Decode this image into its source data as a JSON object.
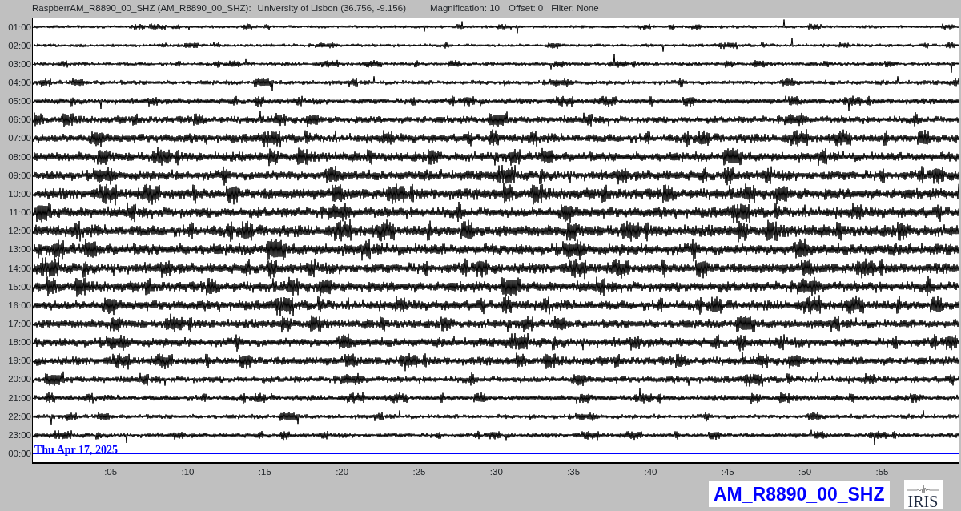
{
  "header": {
    "station": "RaspberrAM_R8890_00_SHZ (AM_R8890_00_SHZ):",
    "location": "University of Lisbon (36.756, -9.156)",
    "magnification": "Magnification: 10",
    "offset": "Offset: 0",
    "filter": "Filter: None"
  },
  "rows": [
    {
      "time": "01:00",
      "kind": "trace"
    },
    {
      "time": "02:00",
      "kind": "trace"
    },
    {
      "time": "03:00",
      "kind": "trace"
    },
    {
      "time": "04:00",
      "kind": "trace"
    },
    {
      "time": "05:00",
      "kind": "trace"
    },
    {
      "time": "06:00",
      "kind": "trace"
    },
    {
      "time": "07:00",
      "kind": "trace"
    },
    {
      "time": "08:00",
      "kind": "trace"
    },
    {
      "time": "09:00",
      "kind": "trace"
    },
    {
      "time": "10:00",
      "kind": "trace"
    },
    {
      "time": "11:00",
      "kind": "trace"
    },
    {
      "time": "12:00",
      "kind": "trace"
    },
    {
      "time": "13:00",
      "kind": "trace"
    },
    {
      "time": "14:00",
      "kind": "trace"
    },
    {
      "time": "15:00",
      "kind": "trace"
    },
    {
      "time": "16:00",
      "kind": "trace"
    },
    {
      "time": "17:00",
      "kind": "trace"
    },
    {
      "time": "18:00",
      "kind": "trace"
    },
    {
      "time": "19:00",
      "kind": "trace"
    },
    {
      "time": "20:00",
      "kind": "trace"
    },
    {
      "time": "21:00",
      "kind": "trace"
    },
    {
      "time": "22:00",
      "kind": "trace"
    },
    {
      "time": "23:00",
      "kind": "trace"
    },
    {
      "time": "00:00",
      "kind": "current",
      "date": "Thu Apr 17, 2025"
    }
  ],
  "x_ticks": [
    ":05",
    ":10",
    ":15",
    ":20",
    ":25",
    ":30",
    ":35",
    ":40",
    ":45",
    ":50",
    ":55"
  ],
  "channel_label": "AM_R8890_00_SHZ",
  "logo": "IRIS"
}
